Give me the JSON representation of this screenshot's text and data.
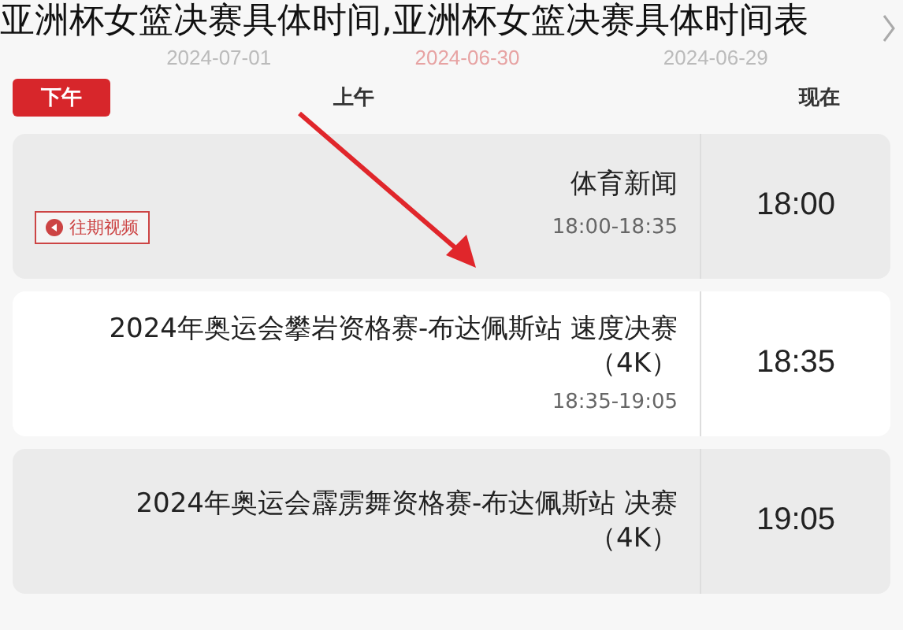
{
  "headline": "亚洲杯女篮决赛具体时间,亚洲杯女篮决赛具体时间表",
  "dates": [
    {
      "label": "2024-07-01",
      "selected": false
    },
    {
      "label": "2024-06-30",
      "selected": true
    },
    {
      "label": "2024-06-29",
      "selected": false
    }
  ],
  "tabs": [
    {
      "label": "下午",
      "selected": true
    },
    {
      "label": "上午",
      "selected": false
    },
    {
      "label": "现在",
      "selected": false
    }
  ],
  "programs": [
    {
      "time": "18:00",
      "title": "体育新闻",
      "range": "18:00-18:35",
      "shaded": true,
      "badge": "往期视频"
    },
    {
      "time": "18:35",
      "title": "2024年奥运会攀岩资格赛-布达佩斯站 速度决赛（4K）",
      "range": "18:35-19:05",
      "shaded": false
    },
    {
      "time": "19:05",
      "title": "2024年奥运会霹雳舞资格赛-布达佩斯站 决赛（4K）",
      "shaded": true
    }
  ]
}
